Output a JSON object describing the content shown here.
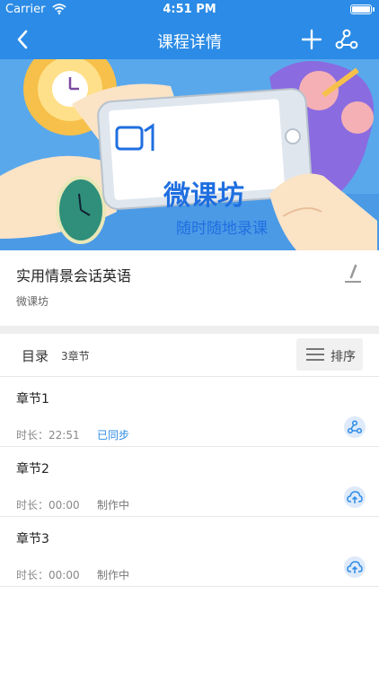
{
  "status_bar": {
    "carrier": "Carrier",
    "time": "4:51 PM"
  },
  "nav": {
    "title": "课程详情",
    "back_icon": "chevron-left-icon",
    "add_icon": "plus-icon",
    "share_icon": "share-icon"
  },
  "banner": {
    "title": "微课坊",
    "subtitle": "随时随地录课"
  },
  "course": {
    "name": "实用情景会话英语",
    "org": "微课坊"
  },
  "catalog": {
    "label": "目录",
    "count": "3章节",
    "sort_label": "排序"
  },
  "chapters": [
    {
      "title": "章节1",
      "duration": "时长：22:51",
      "status": "已同步",
      "status_type": "synced",
      "action_icon": "share-icon"
    },
    {
      "title": "章节2",
      "duration": "时长：00:00",
      "status": "制作中",
      "status_type": "making",
      "action_icon": "cloud-upload-icon"
    },
    {
      "title": "章节3",
      "duration": "时长：00:00",
      "status": "制作中",
      "status_type": "making",
      "action_icon": "cloud-upload-icon"
    }
  ],
  "colors": {
    "primary": "#2b8be6",
    "banner_bg": "#5aa8ec",
    "banner_text": "#1f6fe0"
  }
}
